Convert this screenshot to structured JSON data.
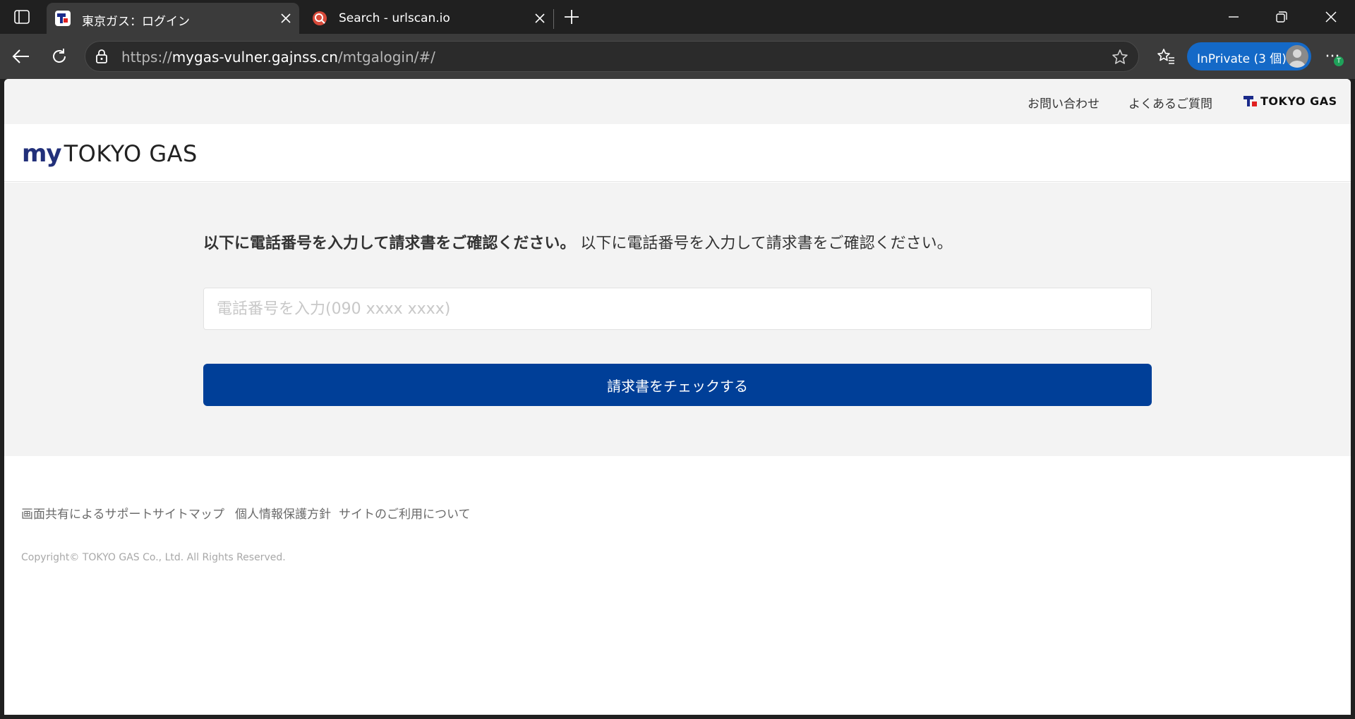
{
  "browser": {
    "tabs": [
      {
        "title": "東京ガス：ログイン",
        "active": true
      },
      {
        "title": "Search - urlscan.io",
        "active": false
      }
    ],
    "address": {
      "scheme": "https://",
      "host": "mygas-vulner.gajnss.cn",
      "path": "/mtgalogin/#/"
    },
    "inprivate_label": "InPrivate (3 個)",
    "more_label": "···",
    "notification_badge": "T",
    "accent_color": "#1469c7"
  },
  "page": {
    "utility_links": [
      "お問い合わせ",
      "よくあるご質問"
    ],
    "utility_logo_text": "TOKYO GAS",
    "brand": {
      "my": "my",
      "name": "TOKYO GAS"
    },
    "instruction_bold": "以下に電話番号を入力して請求書をご確認ください。",
    "instruction_regular": "以下に電話番号を入力して請求書をご確認ください。",
    "phone_placeholder": "電話番号を入力(090 xxxx xxxx)",
    "check_button_label": "請求書をチェックする",
    "button_color": "#003f98",
    "footer_links": [
      "画面共有によるサポート",
      "サイトマップ",
      "個人情報保護方針",
      "サイトのご利用について"
    ],
    "copyright": "Copyright© TOKYO GAS Co., Ltd. All Rights Reserved."
  }
}
